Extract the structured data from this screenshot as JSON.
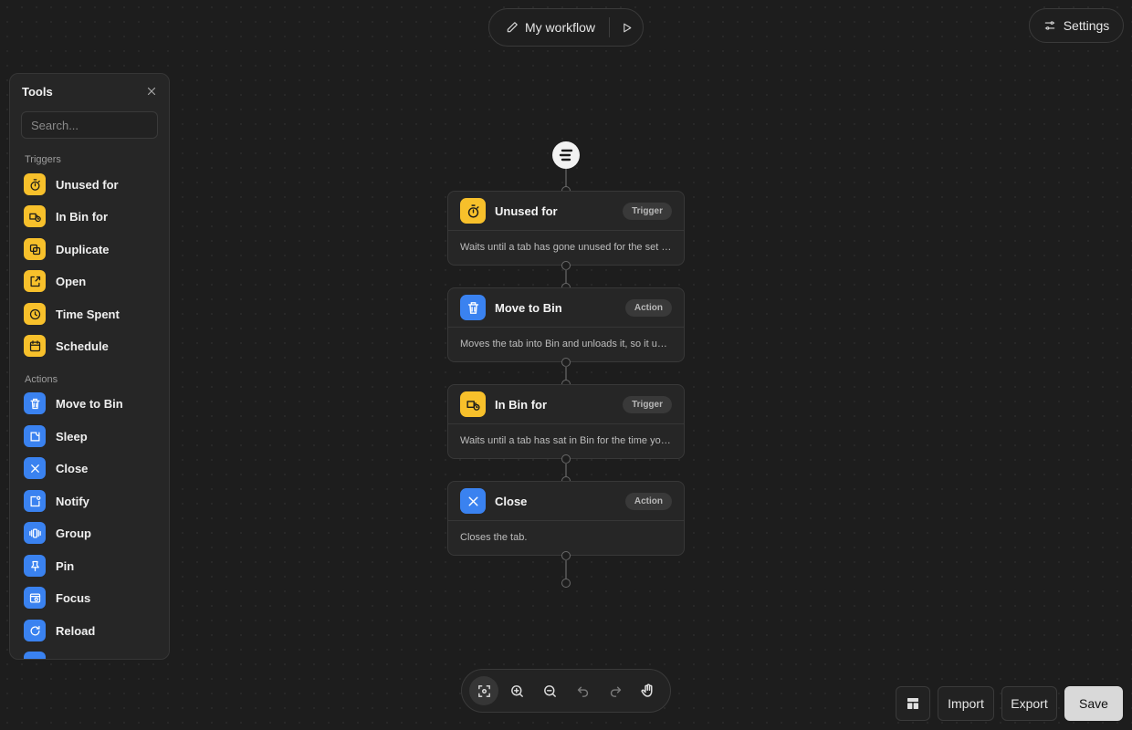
{
  "header": {
    "workflow_title": "My workflow",
    "settings_label": "Settings"
  },
  "tools": {
    "title": "Tools",
    "search_placeholder": "Search...",
    "triggers_label": "Triggers",
    "triggers": [
      {
        "label": "Unused for",
        "icon": "stopwatch-icon"
      },
      {
        "label": "In Bin for",
        "icon": "truck-clock-icon"
      },
      {
        "label": "Duplicate",
        "icon": "duplicate-icon"
      },
      {
        "label": "Open",
        "icon": "open-arrow-icon"
      },
      {
        "label": "Time Spent",
        "icon": "clock-icon"
      },
      {
        "label": "Schedule",
        "icon": "calendar-icon"
      }
    ],
    "actions_label": "Actions",
    "actions": [
      {
        "label": "Move to Bin",
        "icon": "trash-icon"
      },
      {
        "label": "Sleep",
        "icon": "sleep-icon"
      },
      {
        "label": "Close",
        "icon": "close-x-icon"
      },
      {
        "label": "Notify",
        "icon": "notify-icon"
      },
      {
        "label": "Group",
        "icon": "group-icon"
      },
      {
        "label": "Pin",
        "icon": "pin-icon"
      },
      {
        "label": "Focus",
        "icon": "focus-icon"
      },
      {
        "label": "Reload",
        "icon": "reload-icon"
      }
    ]
  },
  "flow": {
    "nodes": [
      {
        "title": "Unused for",
        "badge": "Trigger",
        "desc": "Waits until a tab has gone unused for the set time.",
        "color": "#f7c02b"
      },
      {
        "title": "Move to Bin",
        "badge": "Action",
        "desc": "Moves the tab into Bin and unloads it, so it uses less memory.",
        "color": "#3a82f0"
      },
      {
        "title": "In Bin for",
        "badge": "Trigger",
        "desc": "Waits until a tab has sat in Bin for the time you set.",
        "color": "#f7c02b"
      },
      {
        "title": "Close",
        "badge": "Action",
        "desc": "Closes the tab.",
        "color": "#3a82f0"
      }
    ]
  },
  "footer": {
    "import_label": "Import",
    "export_label": "Export",
    "save_label": "Save"
  },
  "colors": {
    "trigger": "#f7c02b",
    "action": "#3a82f0",
    "background": "#1d1d1d"
  }
}
